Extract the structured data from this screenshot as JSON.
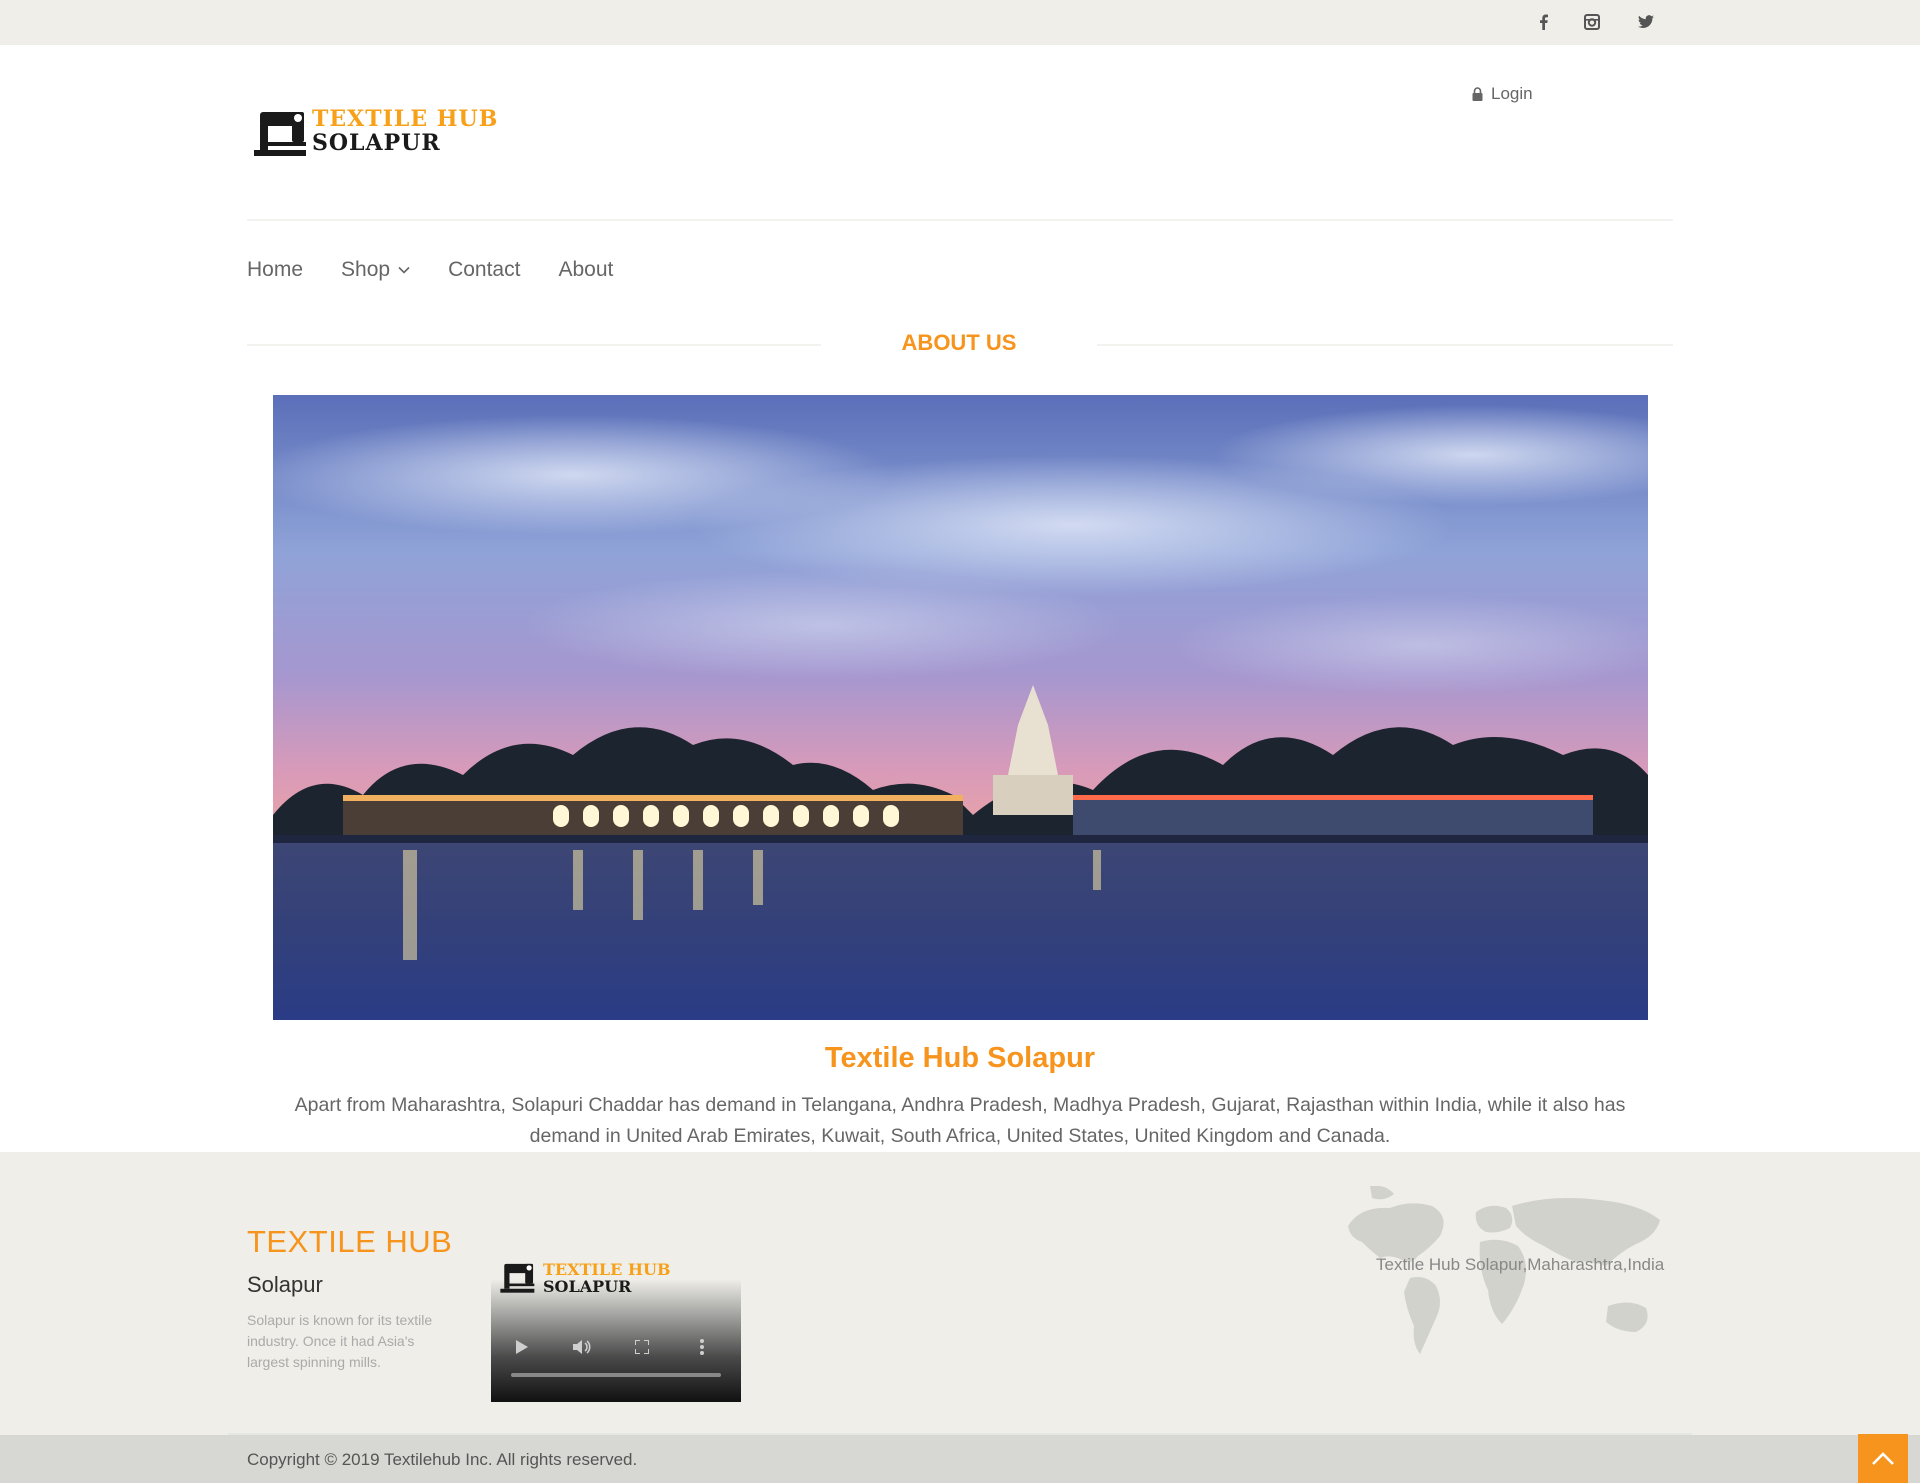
{
  "topbar": {
    "social": [
      {
        "name": "facebook",
        "icon": "facebook-icon"
      },
      {
        "name": "instagram",
        "icon": "instagram-icon"
      },
      {
        "name": "twitter",
        "icon": "twitter-icon"
      }
    ]
  },
  "header": {
    "logo_line1": "TEXTILE HUB",
    "logo_line2": "SOLAPUR",
    "login_label": "Login",
    "login_icon": "lock-icon"
  },
  "nav": {
    "items": [
      {
        "label": "Home"
      },
      {
        "label": "Shop",
        "icon": "chevron-down-icon"
      },
      {
        "label": "Contact"
      },
      {
        "label": "About"
      }
    ]
  },
  "main": {
    "section_title": "ABOUT US",
    "hero_alt": "Temple on lake at dusk",
    "content_title": "Textile Hub Solapur",
    "content_body": "Apart from Maharashtra, Solapuri Chaddar has demand in Telangana, Andhra Pradesh, Madhya Pradesh, Gujarat, Rajasthan within India, while it also has demand in United Arab Emirates, Kuwait, South Africa, United States, United Kingdom and Canada."
  },
  "footer": {
    "brand": "TEXTILE HUB",
    "subtitle": "Solapur",
    "description": "Solapur is known for its textile industry. Once it had Asia's largest spinning mills.",
    "video_logo_line1": "TEXTILE HUB",
    "video_logo_line2": "SOLAPUR",
    "address": "Textile Hub Solapur,Maharashtra,India",
    "copyright": "Copyright © 2019 Textilehub Inc. All rights reserved."
  },
  "colors": {
    "accent": "#f7941d",
    "topbar_bg": "#efeee8",
    "footer_bg": "#efeee8",
    "copybar_bg": "#d7d8d3"
  }
}
